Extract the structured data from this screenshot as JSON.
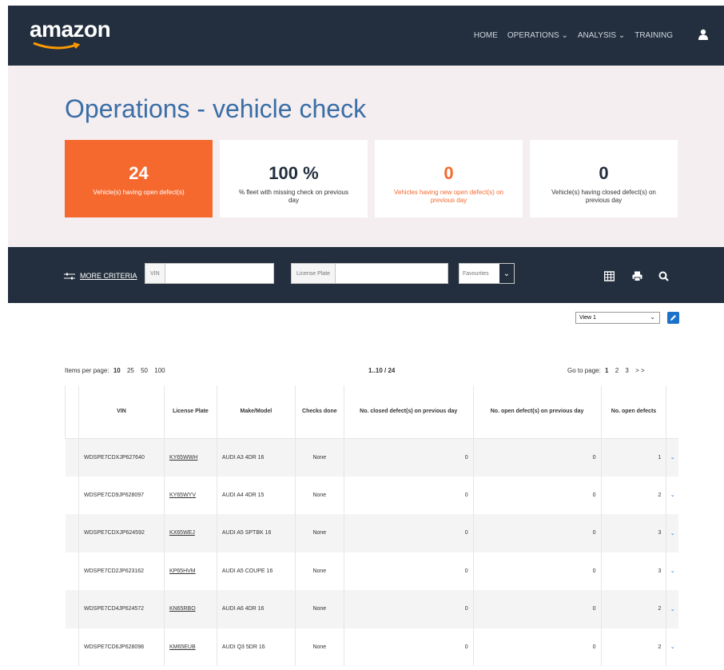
{
  "header": {
    "logo": "amazon",
    "nav": [
      "HOME",
      "OPERATIONS ⌄",
      "ANALYSIS ⌄",
      "TRAINING"
    ]
  },
  "hero": {
    "title": "Operations - vehicle check",
    "cards": [
      {
        "value": "24",
        "label": "Vehicle(s) having open defect(s)",
        "style": "orange"
      },
      {
        "value": "100 %",
        "label": "% fleet with missing check on previous day",
        "style": "plain"
      },
      {
        "value": "0",
        "label": "Vehicles having new open defect(s) on previous day",
        "style": "alert"
      },
      {
        "value": "0",
        "label": "Vehicle(s) having closed defect(s) on previous day",
        "style": "plain"
      }
    ]
  },
  "filter": {
    "more_criteria": "MORE CRITERIA",
    "vin_prefix": "VIN",
    "vin_value": "",
    "plate_prefix": "License Plate",
    "plate_value": "",
    "favourites": "Favourites",
    "icons": [
      "grid-icon",
      "print-icon",
      "search-icon"
    ]
  },
  "view": {
    "selected": "View 1"
  },
  "paging": {
    "items_label": "Items per page:",
    "sizes": [
      "10",
      "25",
      "50",
      "100"
    ],
    "count": "1..10 / 24",
    "goto_label": "Go to page:",
    "pages": [
      "1",
      "2",
      "3"
    ],
    "next": "> >"
  },
  "table": {
    "columns": [
      "VIN",
      "License Plate",
      "Make/Model",
      "Checks done",
      "No. closed defect(s) on previous day",
      "No. open defect(s) on previous day",
      "No. open defects"
    ],
    "rows": [
      {
        "vin": "WDSPE7CDXJP627640",
        "plate": "KY65WWH",
        "model": "AUDI A3 4DR 16",
        "checks": "None",
        "closed": "0",
        "open_prev": "0",
        "open": "1"
      },
      {
        "vin": "WDSPE7CD9JP628097",
        "plate": "KY65WYV",
        "model": "AUDI A4 4DR 15",
        "checks": "None",
        "closed": "0",
        "open_prev": "0",
        "open": "2"
      },
      {
        "vin": "WDSPE7CDXJP624592",
        "plate": "KX65WEJ",
        "model": "AUDI A5 SPTBK 16",
        "checks": "None",
        "closed": "0",
        "open_prev": "0",
        "open": "3"
      },
      {
        "vin": "WDSPE7CD2JP623162",
        "plate": "KP65HVM",
        "model": "AUDI A5 COUPE 16",
        "checks": "None",
        "closed": "0",
        "open_prev": "0",
        "open": "3"
      },
      {
        "vin": "WDSPE7CD4JP624572",
        "plate": "KN65RBO",
        "model": "AUDI A6 4DR 16",
        "checks": "None",
        "closed": "0",
        "open_prev": "0",
        "open": "2"
      },
      {
        "vin": "WDSPE7CD6JP628098",
        "plate": "KM65EUB",
        "model": "AUDI Q3 5DR 16",
        "checks": "None",
        "closed": "0",
        "open_prev": "0",
        "open": "2"
      }
    ]
  },
  "colors": {
    "navy": "#232f3e",
    "orange": "#f5692f",
    "title_blue": "#3a6ea5",
    "link_blue": "#1a73c9"
  }
}
